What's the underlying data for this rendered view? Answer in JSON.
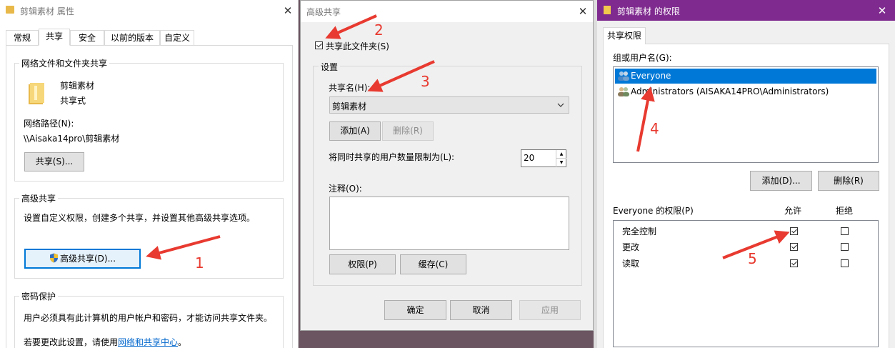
{
  "properties_window": {
    "title": "剪辑素材 属性",
    "tabs": [
      "常规",
      "共享",
      "安全",
      "以前的版本",
      "自定义"
    ],
    "network_group_label": "网络文件和文件夹共享",
    "folder_name": "剪辑素材",
    "folder_status": "共享式",
    "network_path_label": "网络路径(N):",
    "network_path_value": "\\\\Aisaka14pro\\剪辑素材",
    "share_button": "共享(S)...",
    "advanced_group_label": "高级共享",
    "advanced_desc": "设置自定义权限，创建多个共享，并设置其他高级共享选项。",
    "advanced_button": "高级共享(D)...",
    "password_group_label": "密码保护",
    "password_desc": "用户必须具有此计算机的用户帐户和密码，才能访问共享文件夹。",
    "change_prefix": "若要更改此设置，请使用",
    "change_link": "网络和共享中心",
    "change_suffix": "。"
  },
  "advanced_sharing_dialog": {
    "title": "高级共享",
    "share_checkbox_label": "共享此文件夹(S)",
    "share_checked": true,
    "settings_label": "设置",
    "share_name_label": "共享名(H):",
    "share_name_value": "剪辑素材",
    "add_button": "添加(A)",
    "remove_button": "删除(R)",
    "limit_label": "将同时共享的用户数量限制为(L):",
    "limit_value": "20",
    "comment_label": "注释(O):",
    "permissions_button": "权限(P)",
    "cache_button": "缓存(C)",
    "ok_button": "确定",
    "cancel_button": "取消",
    "apply_button": "应用"
  },
  "permissions_window": {
    "title": "剪辑素材 的权限",
    "tab": "共享权限",
    "group_label": "组或用户名(G):",
    "users": [
      "Everyone",
      "Administrators (AISAKA14PRO\\Administrators)"
    ],
    "add_button": "添加(D)...",
    "remove_button": "删除(R)",
    "perm_label": "Everyone 的权限(P)",
    "allow_header": "允许",
    "deny_header": "拒绝",
    "permissions": [
      {
        "name": "完全控制",
        "allow": true,
        "deny": false
      },
      {
        "name": "更改",
        "allow": true,
        "deny": false
      },
      {
        "name": "读取",
        "allow": true,
        "deny": false
      }
    ]
  },
  "annotations": [
    "1",
    "2",
    "3",
    "4",
    "5"
  ],
  "colors": {
    "accent": "#0078d7",
    "annotation": "#e83a30",
    "title_purple": "#7f2a8f",
    "selection": "#0078d7"
  }
}
